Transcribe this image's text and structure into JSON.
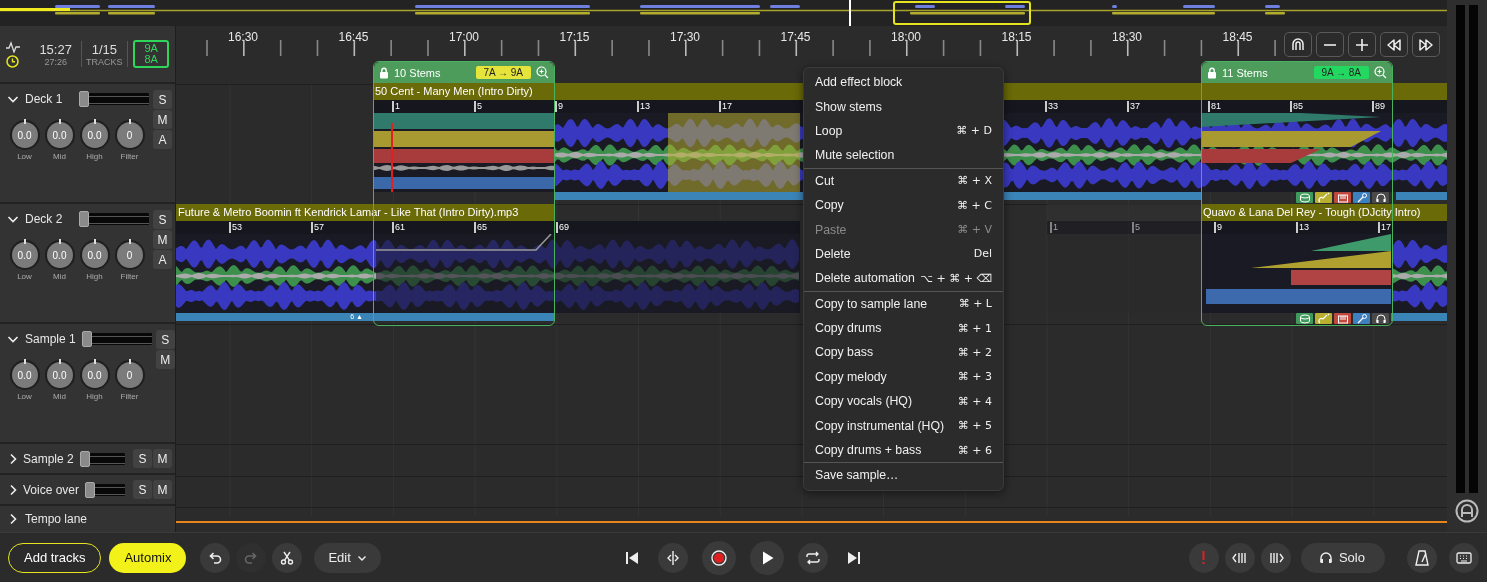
{
  "header": {
    "time": "15:27",
    "remaining": "27:26",
    "track_count": "1/15",
    "tracks_label": "TRACKS",
    "keys": [
      "9A",
      "8A"
    ]
  },
  "lanes": [
    {
      "kind": "deck",
      "name": "Deck 1",
      "expanded": true,
      "level": 0,
      "buttons": [
        "S",
        "M",
        "A"
      ],
      "knobs": [
        {
          "value": "0.0",
          "label": "Low"
        },
        {
          "value": "0.0",
          "label": "Mid"
        },
        {
          "value": "0.0",
          "label": "High"
        },
        {
          "value": "0",
          "label": "Filter"
        }
      ]
    },
    {
      "kind": "deck",
      "name": "Deck 2",
      "expanded": true,
      "level": 0,
      "buttons": [
        "S",
        "M",
        "A"
      ],
      "knobs": [
        {
          "value": "0.0",
          "label": "Low"
        },
        {
          "value": "0.0",
          "label": "Mid"
        },
        {
          "value": "0.0",
          "label": "High"
        },
        {
          "value": "0",
          "label": "Filter"
        }
      ]
    },
    {
      "kind": "deck",
      "name": "Sample 1",
      "expanded": true,
      "level": 0,
      "buttons": [
        "S",
        "M"
      ],
      "knobs": [
        {
          "value": "0.0",
          "label": "Low"
        },
        {
          "value": "0.0",
          "label": "Mid"
        },
        {
          "value": "0.0",
          "label": "High"
        },
        {
          "value": "0",
          "label": "Filter"
        }
      ]
    },
    {
      "kind": "deck",
      "name": "Sample 2",
      "expanded": false,
      "level": 0,
      "buttons": [
        "S",
        "M"
      ]
    },
    {
      "kind": "deck",
      "name": "Voice over",
      "expanded": false,
      "level": 0,
      "buttons": [
        "S",
        "M"
      ]
    },
    {
      "kind": "tempo",
      "name": "Tempo lane",
      "expanded": false
    }
  ],
  "ruler": {
    "times": [
      "16:30",
      "16:45",
      "17:00",
      "17:15",
      "17:30",
      "17:45",
      "18:00",
      "18:15",
      "18:30",
      "18:45"
    ]
  },
  "clips": [
    {
      "title": "50 Cent - Many Men (Intro Dirty)",
      "beats": [
        "1",
        "5",
        "9",
        "13",
        "17",
        "33",
        "37"
      ]
    },
    {
      "beats": [
        "81",
        "85",
        "89"
      ]
    },
    {
      "title": "Future & Metro Boomin ft Kendrick Lamar - Like That (Intro Dirty).mp3",
      "beats": [
        "53",
        "57",
        "61",
        "65",
        "69"
      ],
      "badge": "6 ▲"
    },
    {
      "beats": [
        "1",
        "5"
      ]
    },
    {
      "title": "Quavo & Lana Del Rey - Tough (DJcity Intro)",
      "beats": [
        "9",
        "13",
        "17"
      ]
    }
  ],
  "stem_blocks": [
    {
      "label": "10 Stems",
      "keys": "7A → 9A",
      "color": "#e4e43a",
      "stem_icons": false
    },
    {
      "label": "11 Stems",
      "keys": "9A → 8A",
      "color": "#22d860",
      "stem_icons": true
    }
  ],
  "context_menu": [
    [
      {
        "label": "Add effect block",
        "disabled": false
      },
      {
        "label": "Show stems",
        "disabled": false
      },
      {
        "label": "Loop",
        "shortcut": "⌘ + D",
        "disabled": false
      },
      {
        "label": "Mute selection",
        "disabled": false
      }
    ],
    [
      {
        "label": "Cut",
        "shortcut": "⌘ + X",
        "disabled": false
      },
      {
        "label": "Copy",
        "shortcut": "⌘ + C",
        "disabled": false
      },
      {
        "label": "Paste",
        "shortcut": "⌘ + V",
        "disabled": true
      },
      {
        "label": "Delete",
        "shortcut": "Del",
        "disabled": false
      },
      {
        "label": "Delete automation",
        "shortcut": "⌥ + ⌘ + ⌫",
        "disabled": false
      }
    ],
    [
      {
        "label": "Copy to sample lane",
        "shortcut": "⌘ + L",
        "disabled": false
      },
      {
        "label": "Copy drums",
        "shortcut": "⌘ + 1",
        "disabled": false
      },
      {
        "label": "Copy bass",
        "shortcut": "⌘ + 2",
        "disabled": false
      },
      {
        "label": "Copy melody",
        "shortcut": "⌘ + 3",
        "disabled": false
      },
      {
        "label": "Copy vocals (HQ)",
        "shortcut": "⌘ + 4",
        "disabled": false
      },
      {
        "label": "Copy instrumental (HQ)",
        "shortcut": "⌘ + 5",
        "disabled": false
      },
      {
        "label": "Copy drums + bass",
        "shortcut": "⌘ + 6",
        "disabled": false
      }
    ],
    [
      {
        "label": "Save sample…",
        "disabled": false
      }
    ]
  ],
  "toolbar": {
    "add_tracks": "Add tracks",
    "automix": "Automix",
    "redo_disabled": true,
    "edit": "Edit",
    "solo": "Solo"
  }
}
